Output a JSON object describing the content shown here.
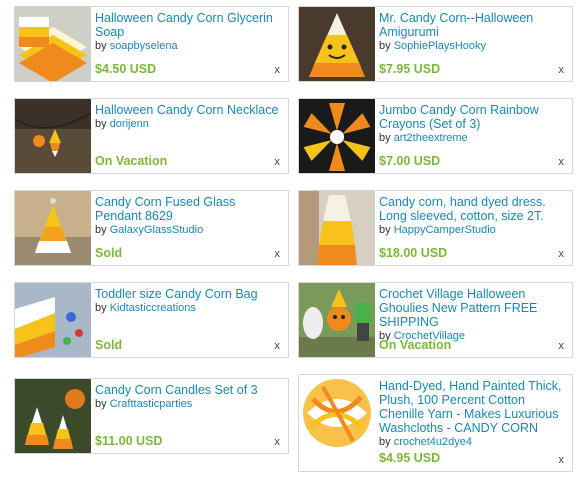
{
  "items": [
    {
      "title": "Halloween Candy Corn Glycerin Soap",
      "by_prefix": "by",
      "shop": "soapbyselena",
      "status": "$4.50 USD",
      "remove": "x"
    },
    {
      "title": "Mr. Candy Corn--Halloween Amigurumi",
      "by_prefix": "by",
      "shop": "SophiePlaysHooky",
      "status": "$7.95 USD",
      "remove": "x"
    },
    {
      "title": "Halloween Candy Corn Necklace",
      "by_prefix": "by",
      "shop": "dorijenn",
      "status": "On Vacation",
      "remove": "x"
    },
    {
      "title": "Jumbo Candy Corn Rainbow Crayons (Set of 3)",
      "by_prefix": "by",
      "shop": "art2theextreme",
      "status": "$7.00 USD",
      "remove": "x"
    },
    {
      "title": "Candy Corn Fused Glass Pendant 8629",
      "by_prefix": "by",
      "shop": "GalaxyGlassStudio",
      "status": "Sold",
      "remove": "x"
    },
    {
      "title": "Candy corn, hand dyed dress. Long sleeved, cotton, size 2T.",
      "by_prefix": "by",
      "shop": "HappyCamperStudio",
      "status": "$18.00 USD",
      "remove": "x"
    },
    {
      "title": "Toddler size Candy Corn Bag",
      "by_prefix": "by",
      "shop": "Kidtasticcreations",
      "status": "Sold",
      "remove": "x"
    },
    {
      "title": "Crochet Village Halloween Ghoulies New Pattern FREE SHIPPING",
      "by_prefix": "by",
      "shop": "CrochetVillage",
      "status": "On Vacation",
      "remove": "x"
    },
    {
      "title": "Candy Corn Candles Set of 3",
      "by_prefix": "by",
      "shop": "Crafttasticparties",
      "status": "$11.00 USD",
      "remove": "x"
    },
    {
      "title": "Hand-Dyed, Hand Painted Thick, Plush, 100 Percent Cotton Chenille Yarn - Makes Luxurious Washcloths - CANDY CORN",
      "by_prefix": "by",
      "shop": "crochet4u2dye4",
      "status": "$4.95 USD",
      "remove": "x"
    }
  ]
}
